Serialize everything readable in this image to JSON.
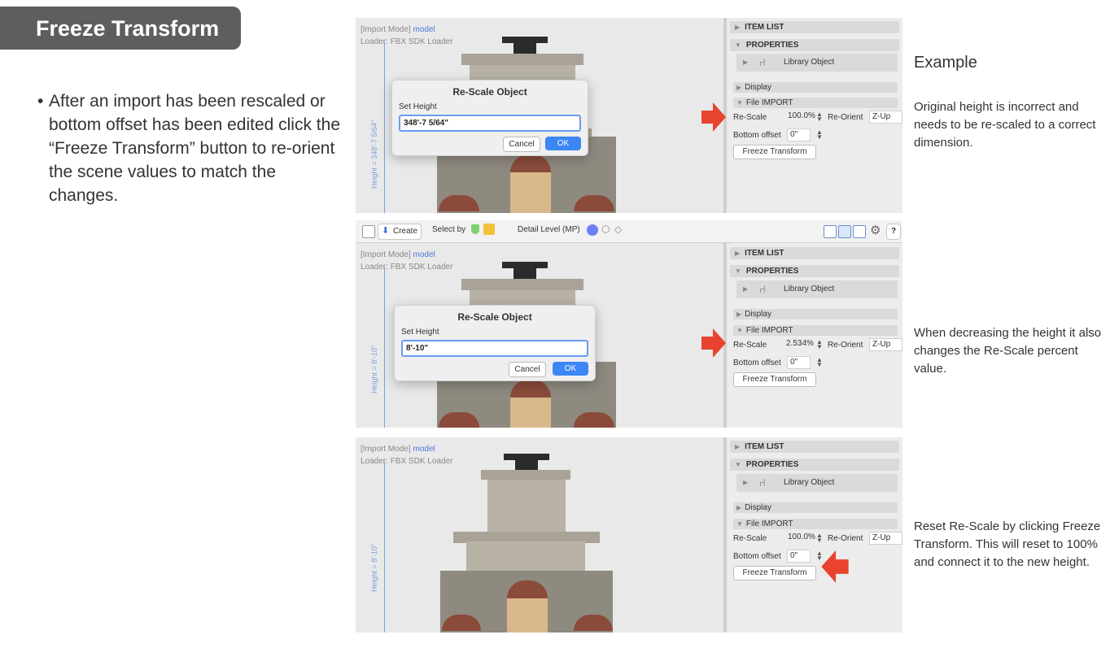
{
  "header": {
    "title": "Freeze Transform"
  },
  "bullet_text": "After an import has been rescaled or bottom offset has been edited click the “Freeze Transform” button to re-orient the scene values to match the changes.",
  "example_title": "Example",
  "notes": [
    "Original height is incorrect and needs to be re-scaled to a correct dimension.",
    "When decreasing the height it also changes the Re-Scale percent value.",
    "Reset Re-Scale by clicking Freeze Transform. This will reset to 100% and connect it to the new height."
  ],
  "toolbar": {
    "create_label": "Create",
    "select_by_label": "Select by",
    "detail_level_label": "Detail Level (MP)",
    "help_label": "?"
  },
  "viewport": {
    "mode_prefix": "[Import Mode]",
    "mode_value": "model",
    "loader": "Loader: FBX SDK Loader"
  },
  "dialog": {
    "title": "Re-Scale Object",
    "set_height_label": "Set Height",
    "cancel_label": "Cancel",
    "ok_label": "OK"
  },
  "sidepanel": {
    "item_list": "ITEM LIST",
    "properties": "PROPERTIES",
    "library_object": "Library Object",
    "display": "Display",
    "file_import": "File IMPORT",
    "rescale_label": "Re-Scale",
    "reorient_label": "Re-Orient",
    "reorient_value": "Z-Up",
    "bottom_offset_label": "Bottom offset",
    "bottom_offset_value": "0\"",
    "freeze_button": "Freeze Transform"
  },
  "screens": [
    {
      "height_label": "Height = 348'-7 5/64\"",
      "dialog_value": "348'-7 5/64\"",
      "rescale_value": "100.0%"
    },
    {
      "height_label": "Height = 8'-10\"",
      "dialog_value": "8'-10\"",
      "rescale_value": "2.534%"
    },
    {
      "height_label": "Height = 8'-10\"",
      "rescale_value": "100.0%"
    }
  ],
  "colors": {
    "accent_red": "#e8432f",
    "ok_blue": "#3c86f5",
    "title_bg": "#5d5e60"
  }
}
